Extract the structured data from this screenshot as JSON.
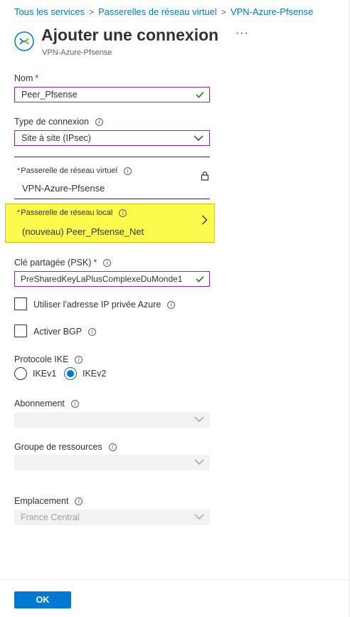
{
  "breadcrumb": {
    "items": [
      "Tous les services",
      "Passerelles de réseau virtuel",
      "VPN-Azure-Pfsense"
    ],
    "separator": ">"
  },
  "header": {
    "title": "Ajouter une connexion",
    "subtitle": "VPN-Azure-Pfsense",
    "more": "···"
  },
  "form": {
    "name": {
      "label": "Nom",
      "required": "*",
      "value": "Peer_Pfsense"
    },
    "connection_type": {
      "label": "Type de connexion",
      "value": "Site à site (IPsec)"
    },
    "vnet_gateway": {
      "required": "*",
      "label": "Passerelle de réseau virtuel",
      "value": "VPN-Azure-Pfsense"
    },
    "local_gateway": {
      "required": "*",
      "label": "Passerelle de réseau local",
      "value": "(nouveau) Peer_Pfsense_Net"
    },
    "psk": {
      "label": "Clé partagée (PSK)",
      "required": "*",
      "value": "PreSharedKeyLaPlusComplexeDuMonde1"
    },
    "private_ip": {
      "label": "Utiliser l'adresse IP privée Azure",
      "checked": false
    },
    "bgp": {
      "label": "Activer BGP",
      "checked": false
    },
    "ike": {
      "label": "Protocole IKE",
      "options": [
        "IKEv1",
        "IKEv2"
      ],
      "selected": "IKEv2"
    },
    "subscription": {
      "label": "Abonnement",
      "value": ""
    },
    "resource_group": {
      "label": "Groupe de ressources",
      "value": ""
    },
    "location": {
      "label": "Emplacement",
      "value": "France Central"
    }
  },
  "footer": {
    "ok_label": "OK"
  },
  "colors": {
    "accent": "#0078d4",
    "focus_border": "#8a2da5",
    "highlight": "#fbfb4e",
    "valid_check": "#107c10",
    "required": "#a4262c"
  }
}
